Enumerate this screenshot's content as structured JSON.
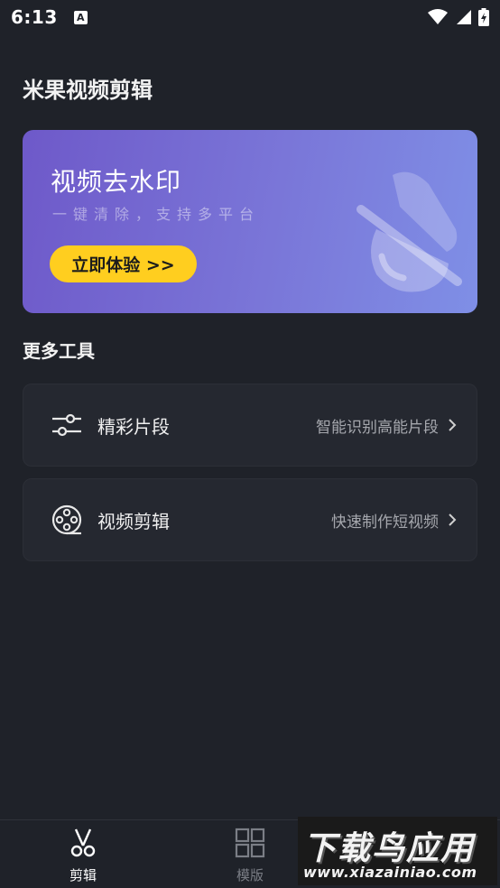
{
  "status_bar": {
    "time": "6:13",
    "notification_badge": "A"
  },
  "header": {
    "title": "米果视频剪辑"
  },
  "banner": {
    "title": "视频去水印",
    "subtitle": "一键清除，支持多平台",
    "button_label": "立即体验 >>",
    "button_color": "#ffce1f"
  },
  "tools_section": {
    "title": "更多工具",
    "items": [
      {
        "label": "精彩片段",
        "description": "智能识别高能片段",
        "icon": "sliders-icon"
      },
      {
        "label": "视频剪辑",
        "description": "快速制作短视频",
        "icon": "film-reel-icon"
      }
    ]
  },
  "bottom_nav": {
    "items": [
      {
        "label": "剪辑",
        "icon": "scissors-icon",
        "active": true
      },
      {
        "label": "模版",
        "icon": "grid-icon",
        "active": false
      }
    ]
  },
  "watermark": {
    "title": "下载鸟应用",
    "url": "www.xiazainiao.com"
  }
}
